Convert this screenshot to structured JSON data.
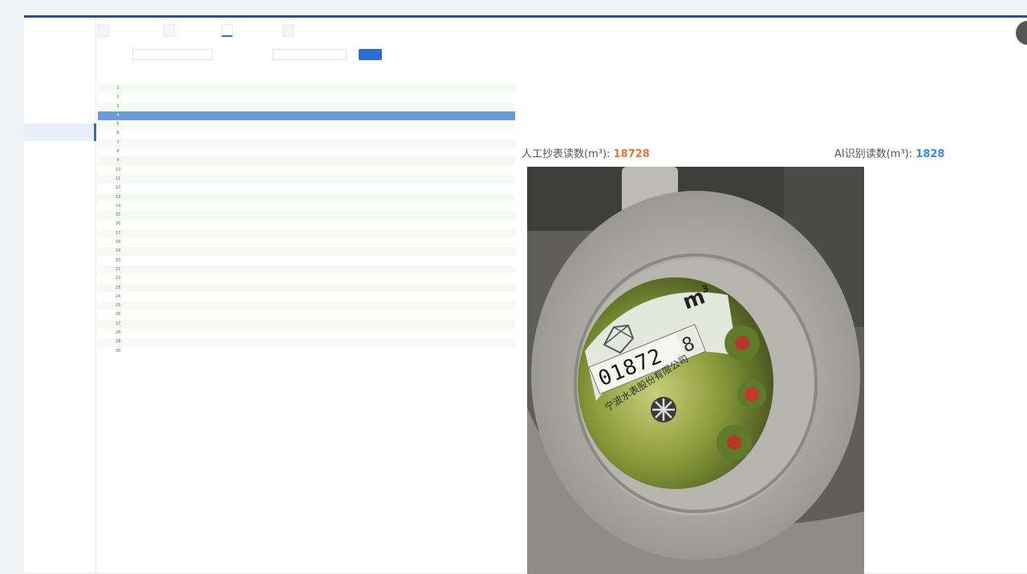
{
  "app": {
    "corner_icon": "user-avatar-icon"
  },
  "sidebar": {
    "items": [
      {
        "label": "",
        "active": false,
        "sub": false
      },
      {
        "label": "",
        "active": false,
        "sub": false
      },
      {
        "label": "",
        "active": false,
        "sub": false
      },
      {
        "label": "",
        "active": false,
        "sub": false
      },
      {
        "label": "",
        "active": true,
        "sub": true
      },
      {
        "label": "",
        "active": false,
        "sub": true
      },
      {
        "label": "",
        "active": false,
        "sub": true
      },
      {
        "label": "",
        "active": false,
        "sub": true
      },
      {
        "label": "",
        "active": false,
        "sub": true
      },
      {
        "label": "",
        "active": false,
        "sub": true
      },
      {
        "label": "",
        "active": false,
        "sub": true
      },
      {
        "label": "",
        "active": false,
        "sub": true
      },
      {
        "label": "",
        "active": false,
        "sub": true
      },
      {
        "label": "",
        "active": false,
        "sub": false
      },
      {
        "label": "",
        "active": false,
        "sub": false
      }
    ]
  },
  "tabs": [
    {
      "label": "",
      "active": false
    },
    {
      "label": "",
      "active": false
    },
    {
      "label": "",
      "active": true
    },
    {
      "label": "",
      "active": false
    }
  ],
  "filter": {
    "month_label": "",
    "month_value": "",
    "status_label": "",
    "status_placeholder": "",
    "search_button": ""
  },
  "table": {
    "columns": [
      "",
      "",
      "",
      "",
      "",
      ""
    ],
    "rows": [
      [
        "1",
        "",
        "",
        "",
        "",
        ""
      ],
      [
        "2",
        "",
        "",
        "",
        "",
        ""
      ],
      [
        "3",
        "",
        "",
        "",
        "",
        ""
      ],
      [
        "4",
        "",
        "",
        "",
        "",
        ""
      ],
      [
        "5",
        "",
        "",
        "",
        "",
        ""
      ],
      [
        "6",
        "",
        "",
        "",
        "",
        ""
      ],
      [
        "7",
        "",
        "",
        "",
        "",
        ""
      ],
      [
        "8",
        "",
        "",
        "",
        "",
        ""
      ],
      [
        "9",
        "",
        "",
        "",
        "",
        ""
      ],
      [
        "10",
        "",
        "",
        "",
        "",
        ""
      ],
      [
        "11",
        "",
        "",
        "",
        "",
        ""
      ],
      [
        "12",
        "",
        "",
        "",
        "",
        ""
      ],
      [
        "13",
        "",
        "",
        "",
        "",
        ""
      ],
      [
        "14",
        "",
        "",
        "",
        "",
        ""
      ],
      [
        "15",
        "",
        "",
        "",
        "",
        ""
      ],
      [
        "16",
        "",
        "",
        "",
        "",
        ""
      ],
      [
        "17",
        "",
        "",
        "",
        "",
        ""
      ],
      [
        "18",
        "",
        "",
        "",
        "",
        ""
      ],
      [
        "19",
        "",
        "",
        "",
        "",
        ""
      ],
      [
        "20",
        "",
        "",
        "",
        "",
        ""
      ],
      [
        "21",
        "",
        "",
        "",
        "",
        ""
      ],
      [
        "22",
        "",
        "",
        "",
        "",
        ""
      ],
      [
        "23",
        "",
        "",
        "",
        "",
        ""
      ],
      [
        "24",
        "",
        "",
        "",
        "",
        ""
      ],
      [
        "25",
        "",
        "",
        "",
        "",
        ""
      ],
      [
        "26",
        "",
        "",
        "",
        "",
        ""
      ],
      [
        "27",
        "",
        "",
        "",
        "",
        ""
      ],
      [
        "28",
        "",
        "",
        "",
        "",
        ""
      ],
      [
        "29",
        "",
        "",
        "",
        "",
        ""
      ],
      [
        "30",
        "",
        "",
        "",
        "",
        ""
      ]
    ],
    "selected_row": 3
  },
  "detail": {
    "section1_title": "",
    "name_line": "",
    "code_line": "",
    "water_line": "",
    "addr_line": "",
    "section2_title": "",
    "reader_line": "",
    "month_line": "",
    "manual_label": "人工抄表读数(m³):",
    "manual_value": "18728",
    "ai_label": "AI识别读数(m³):",
    "ai_value": "1828"
  },
  "photo": {
    "digits": "01872",
    "last_digit": "8",
    "unit": "m",
    "unit_sup": "3",
    "brand": "宁波水表股份有限公司",
    "timestamp": ""
  }
}
